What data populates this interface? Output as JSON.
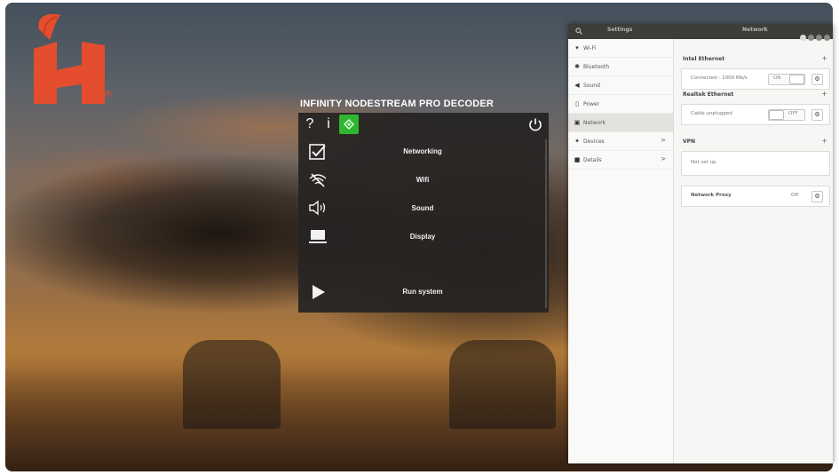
{
  "logo": {
    "letter": "H",
    "registered": "®"
  },
  "decoder": {
    "title": "INFINITY NODESTREAM PRO DECODER",
    "toolbar": {
      "help": "?",
      "info": "i"
    },
    "items": [
      {
        "label": "Networking",
        "icon": "checkbox-checked-icon"
      },
      {
        "label": "Wifi",
        "icon": "wifi-off-icon"
      },
      {
        "label": "Sound",
        "icon": "speaker-icon"
      },
      {
        "label": "Display",
        "icon": "monitor-icon"
      },
      {
        "label": "Run system",
        "icon": "play-icon"
      }
    ]
  },
  "settings": {
    "header": {
      "app": "Settings",
      "section": "Network"
    },
    "nav": [
      {
        "label": "Wi-Fi",
        "icon": "wifi-icon"
      },
      {
        "label": "Bluetooth",
        "icon": "bluetooth-icon"
      },
      {
        "label": "Sound",
        "icon": "speaker-icon"
      },
      {
        "label": "Power",
        "icon": "battery-icon"
      },
      {
        "label": "Network",
        "icon": "network-icon",
        "active": true
      },
      {
        "label": "Devices",
        "icon": "devices-icon",
        "chevron": ">"
      },
      {
        "label": "Details",
        "icon": "details-icon",
        "chevron": ">"
      }
    ],
    "intel": {
      "title": "Intel Ethernet",
      "status": "Connected - 1000 Mb/s",
      "toggle": "ON"
    },
    "realtek": {
      "title": "Realtek Ethernet",
      "status": "Cable unplugged",
      "toggle": "OFF"
    },
    "vpn": {
      "title": "VPN",
      "status": "Not set up"
    },
    "proxy": {
      "title": "Network Proxy",
      "value": "Off"
    }
  },
  "colors": {
    "logo": "#e44d2e",
    "decoder_accent": "#2fb52f"
  }
}
